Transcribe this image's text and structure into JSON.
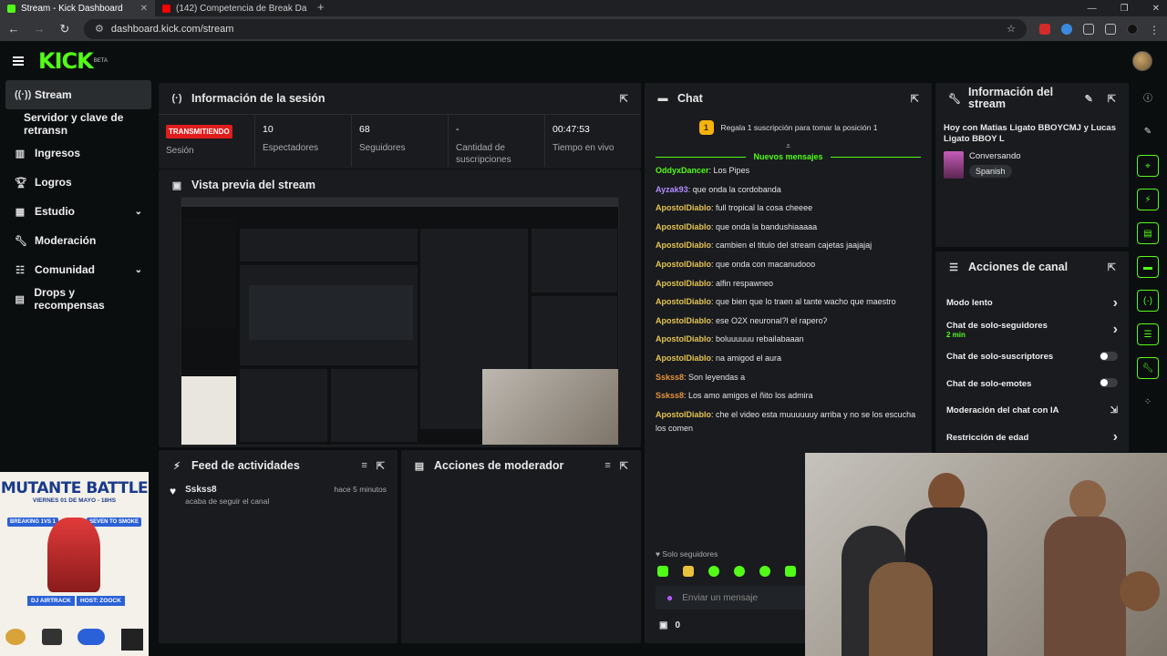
{
  "browser": {
    "tabs": [
      {
        "title": "Stream - Kick Dashboard",
        "active": true
      },
      {
        "title": "(142) Competencia de Break Da",
        "active": false
      }
    ],
    "url": "dashboard.kick.com/stream"
  },
  "app": {
    "logo": "KICK",
    "beta": "BETA"
  },
  "sidebar": {
    "items": [
      {
        "label": "Stream",
        "icon": "broadcast-icon"
      },
      {
        "label": "Servidor y clave de retransn",
        "icon": ""
      },
      {
        "label": "Ingresos",
        "icon": "chart-icon"
      },
      {
        "label": "Logros",
        "icon": "trophy-icon"
      },
      {
        "label": "Estudio",
        "icon": "grid-icon"
      },
      {
        "label": "Moderación",
        "icon": "wrench-icon"
      },
      {
        "label": "Comunidad",
        "icon": "people-icon"
      },
      {
        "label": "Drops y recompensas",
        "icon": "gift-icon"
      }
    ]
  },
  "session": {
    "title": "Información de la sesión",
    "live_badge": "TRANSMITIENDO",
    "session_label": "Sesión",
    "viewers": "10",
    "viewers_label": "Espectadores",
    "followers": "68",
    "followers_label": "Seguidores",
    "subs": "-",
    "subs_label": "Cantidad de suscripciones",
    "uptime": "00:47:53",
    "uptime_label": "Tiempo en vivo"
  },
  "preview": {
    "title": "Vista previa del stream"
  },
  "activity": {
    "title": "Feed de actividades",
    "items": [
      {
        "user": "Sskss8",
        "text": "acaba de seguir el canal",
        "time": "hace 5 minutos"
      }
    ]
  },
  "modactions": {
    "title": "Acciones de moderador"
  },
  "chat": {
    "title": "Chat",
    "promo": "Regala 1 suscripción para tomar la posición 1",
    "promo_rank": "1",
    "new_messages": "Nuevos mensajes",
    "messages": [
      {
        "user": "OddyxDancer",
        "color": "green",
        "text": "Los Pipes"
      },
      {
        "user": "Ayzak93",
        "color": "purple",
        "text": "que onda la cordobanda"
      },
      {
        "user": "ApostolDiablo",
        "color": "yellow",
        "text": "full tropical la cosa cheeee"
      },
      {
        "user": "ApostolDiablo",
        "color": "yellow",
        "text": "que onda la bandushiaaaaa"
      },
      {
        "user": "ApostolDiablo",
        "color": "yellow",
        "text": "cambien el titulo del stream cajetas jaajajaj"
      },
      {
        "user": "ApostolDiablo",
        "color": "yellow",
        "text": "que onda con macanudooo"
      },
      {
        "user": "ApostolDiablo",
        "color": "yellow",
        "text": "alfin respawneo"
      },
      {
        "user": "ApostolDiablo",
        "color": "yellow",
        "text": "que bien que lo traen al tante wacho que maestro"
      },
      {
        "user": "ApostolDiablo",
        "color": "yellow",
        "text": "ese O2X neuronal?l el raperoʔ"
      },
      {
        "user": "ApostolDiablo",
        "color": "yellow",
        "text": "boluuuuuu rebailabaaan"
      },
      {
        "user": "ApostolDiablo",
        "color": "yellow",
        "text": "na amigod el aura"
      },
      {
        "user": "Sskss8",
        "color": "orange",
        "text": "Son leyendas a"
      },
      {
        "user": "Sskss8",
        "color": "orange",
        "text": "Los amo amigos el ñito los admira"
      },
      {
        "user": "ApostolDiablo",
        "color": "yellow",
        "text": "che el video esta muuuuuuy arriba y no se los escucha"
      }
    ],
    "last_continuation": "los comen",
    "followers_only": "Solo seguidores",
    "input_placeholder": "Enviar un mensaje",
    "gift_count": "0"
  },
  "streaminfo": {
    "title": "Información del stream",
    "stream_title": "Hoy con Matias Ligato BBOYCMJ y Lucas Ligato BBOY L",
    "category": "Conversando",
    "language": "Spanish"
  },
  "channelactions": {
    "title": "Acciones de canal",
    "items": [
      {
        "label": "Modo lento",
        "control": "chevron",
        "sub": ""
      },
      {
        "label": "Chat de solo-seguidores",
        "control": "chevron",
        "sub": "2 min"
      },
      {
        "label": "Chat de solo-suscriptores",
        "control": "toggle",
        "sub": ""
      },
      {
        "label": "Chat de solo-emotes",
        "control": "toggle",
        "sub": ""
      },
      {
        "label": "Moderación del chat con IA",
        "control": "external",
        "sub": ""
      },
      {
        "label": "Restricción de edad",
        "control": "chevron",
        "sub": ""
      }
    ]
  },
  "overlay": {
    "promo_title": "MUTANTE BATTLE",
    "promo_date": "VIERNES 01 DE MAYO - 18HS",
    "promo_left": "BREAKING 1VS 1",
    "promo_right": "SEVEN TO SMOKE",
    "promo_host1": "DJ AIRTRACK",
    "promo_host2": "HOST: ZOOCK"
  },
  "colors": {
    "accent": "#53fc18",
    "live": "#e01d1d",
    "panel": "#191b1f"
  }
}
